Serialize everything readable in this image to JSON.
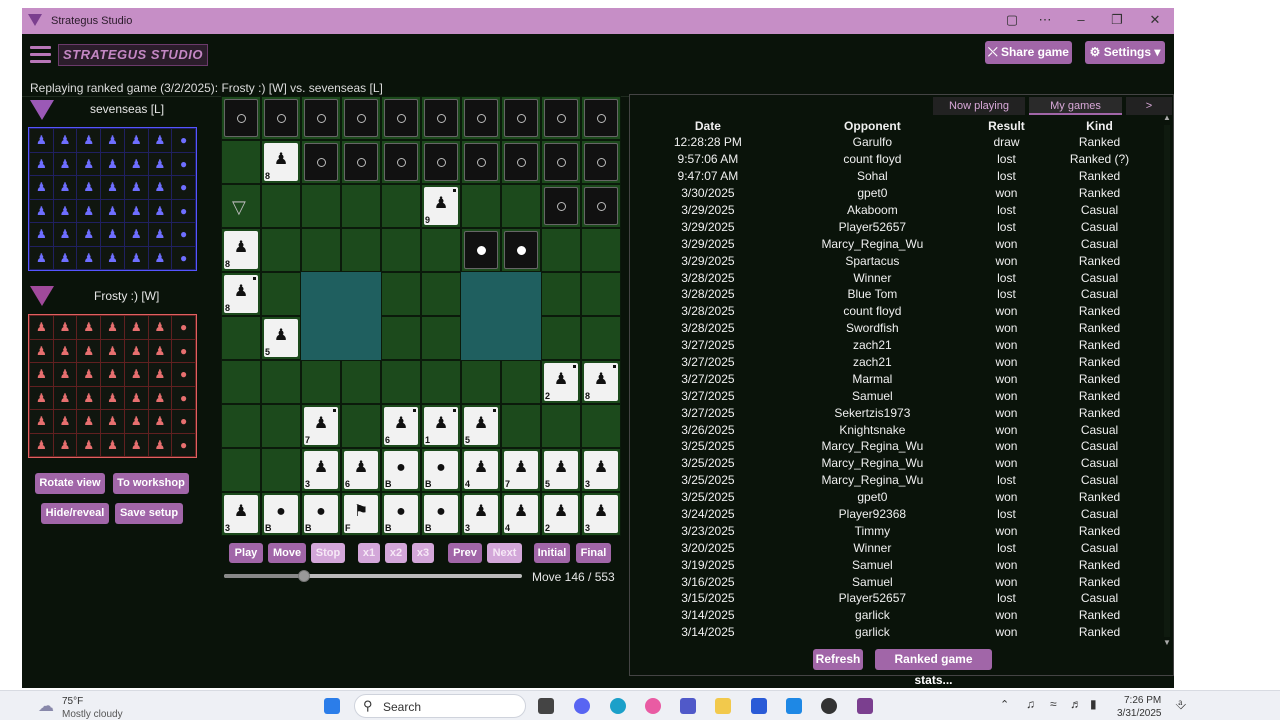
{
  "window": {
    "title": "Strategus Studio"
  },
  "header": {
    "brand": "STRATEGUS STUDIO",
    "share": "Share game",
    "settings": "Settings"
  },
  "subtitle": "Replaying ranked game (3/2/2025): Frosty :) [W] vs. sevenseas [L]",
  "players": {
    "top": "sevenseas [L]",
    "bottom": "Frosty :) [W]"
  },
  "left_buttons": {
    "rotate": "Rotate view",
    "workshop": "To workshop",
    "hide": "Hide/reveal",
    "save": "Save setup"
  },
  "controls": {
    "play": "Play",
    "move": "Move",
    "stop": "Stop",
    "x1": "x1",
    "x2": "x2",
    "x3": "x3",
    "prev": "Prev",
    "next": "Next",
    "initial": "Initial",
    "final": "Final",
    "move_text": "Move 146 / 553",
    "progress": 0.264
  },
  "tabs": {
    "now_playing": "Now playing",
    "my_games": "My games",
    "more": ">"
  },
  "table": {
    "headers": [
      "Date",
      "Opponent",
      "Result",
      "Kind"
    ],
    "rows": [
      [
        "12:28:28 PM",
        "Garulfo",
        "draw",
        "Ranked"
      ],
      [
        "9:57:06 AM",
        "count floyd",
        "lost",
        "Ranked (?)"
      ],
      [
        "9:47:07 AM",
        "Sohal",
        "lost",
        "Ranked"
      ],
      [
        "3/30/2025",
        "gpet0",
        "won",
        "Ranked"
      ],
      [
        "3/29/2025",
        "Akaboom",
        "lost",
        "Casual"
      ],
      [
        "3/29/2025",
        "Player52657",
        "lost",
        "Casual"
      ],
      [
        "3/29/2025",
        "Marcy_Regina_Wu",
        "won",
        "Casual"
      ],
      [
        "3/29/2025",
        "Spartacus",
        "won",
        "Ranked"
      ],
      [
        "3/28/2025",
        "Winner",
        "lost",
        "Casual"
      ],
      [
        "3/28/2025",
        "Blue Tom",
        "lost",
        "Casual"
      ],
      [
        "3/28/2025",
        "count floyd",
        "won",
        "Ranked"
      ],
      [
        "3/28/2025",
        "Swordfish",
        "won",
        "Ranked"
      ],
      [
        "3/27/2025",
        "zach21",
        "won",
        "Ranked"
      ],
      [
        "3/27/2025",
        "zach21",
        "won",
        "Ranked"
      ],
      [
        "3/27/2025",
        "Marmal",
        "won",
        "Ranked"
      ],
      [
        "3/27/2025",
        "Samuel",
        "won",
        "Ranked"
      ],
      [
        "3/27/2025",
        "Sekertzis1973",
        "won",
        "Ranked"
      ],
      [
        "3/26/2025",
        "Knightsnake",
        "won",
        "Casual"
      ],
      [
        "3/25/2025",
        "Marcy_Regina_Wu",
        "won",
        "Casual"
      ],
      [
        "3/25/2025",
        "Marcy_Regina_Wu",
        "won",
        "Casual"
      ],
      [
        "3/25/2025",
        "Marcy_Regina_Wu",
        "lost",
        "Casual"
      ],
      [
        "3/25/2025",
        "gpet0",
        "won",
        "Ranked"
      ],
      [
        "3/24/2025",
        "Player92368",
        "lost",
        "Casual"
      ],
      [
        "3/23/2025",
        "Timmy",
        "won",
        "Ranked"
      ],
      [
        "3/20/2025",
        "Winner",
        "lost",
        "Casual"
      ],
      [
        "3/19/2025",
        "Samuel",
        "won",
        "Ranked"
      ],
      [
        "3/16/2025",
        "Samuel",
        "won",
        "Ranked"
      ],
      [
        "3/15/2025",
        "Player52657",
        "lost",
        "Casual"
      ],
      [
        "3/14/2025",
        "garlick",
        "won",
        "Ranked"
      ],
      [
        "3/14/2025",
        "garlick",
        "won",
        "Ranked"
      ]
    ]
  },
  "bottom_buttons": {
    "refresh": "Refresh",
    "stats": "Ranked game stats..."
  },
  "board": {
    "rows": [
      [
        "D",
        "D",
        "D",
        "D",
        "D",
        "D",
        "D",
        "D",
        "D",
        "D"
      ],
      [
        "G",
        "P8",
        "D",
        "D",
        "D",
        "D",
        "D",
        "D",
        "D",
        "D"
      ],
      [
        "UP",
        "G",
        "G",
        "G",
        "G",
        "P9*",
        "G",
        "G",
        "D",
        "D"
      ],
      [
        "P8",
        "G",
        "G",
        "G",
        "G",
        "G",
        "DF",
        "DF",
        "G",
        "G"
      ],
      [
        "P8*",
        "G",
        "L",
        "L",
        "G",
        "G",
        "L",
        "L",
        "G",
        "G"
      ],
      [
        "G",
        "P5",
        "L",
        "L",
        "G",
        "G",
        "L",
        "L",
        "G",
        "G"
      ],
      [
        "G",
        "G",
        "G",
        "G",
        "G",
        "G",
        "G",
        "G",
        "P2*",
        "P8*"
      ],
      [
        "G",
        "G",
        "P7*",
        "G",
        "P6*",
        "P1*",
        "P5*",
        "G",
        "G",
        "G"
      ],
      [
        "G",
        "G",
        "P3",
        "P6",
        "PB",
        "PB",
        "P4",
        "P7",
        "P5",
        "P3"
      ],
      [
        "P3",
        "PB",
        "PB",
        "PF",
        "PB",
        "PB",
        "P3",
        "P4",
        "P2",
        "P3"
      ]
    ]
  },
  "taskbar": {
    "temp": "75°F",
    "weather": "Mostly cloudy",
    "search": "Search",
    "time": "7:26 PM",
    "date": "3/31/2025"
  },
  "colors": {
    "accent": "#a166a8",
    "title_bar": "#c68ec6",
    "blue_army": "#6e6eff",
    "red_army": "#e76f6f"
  }
}
